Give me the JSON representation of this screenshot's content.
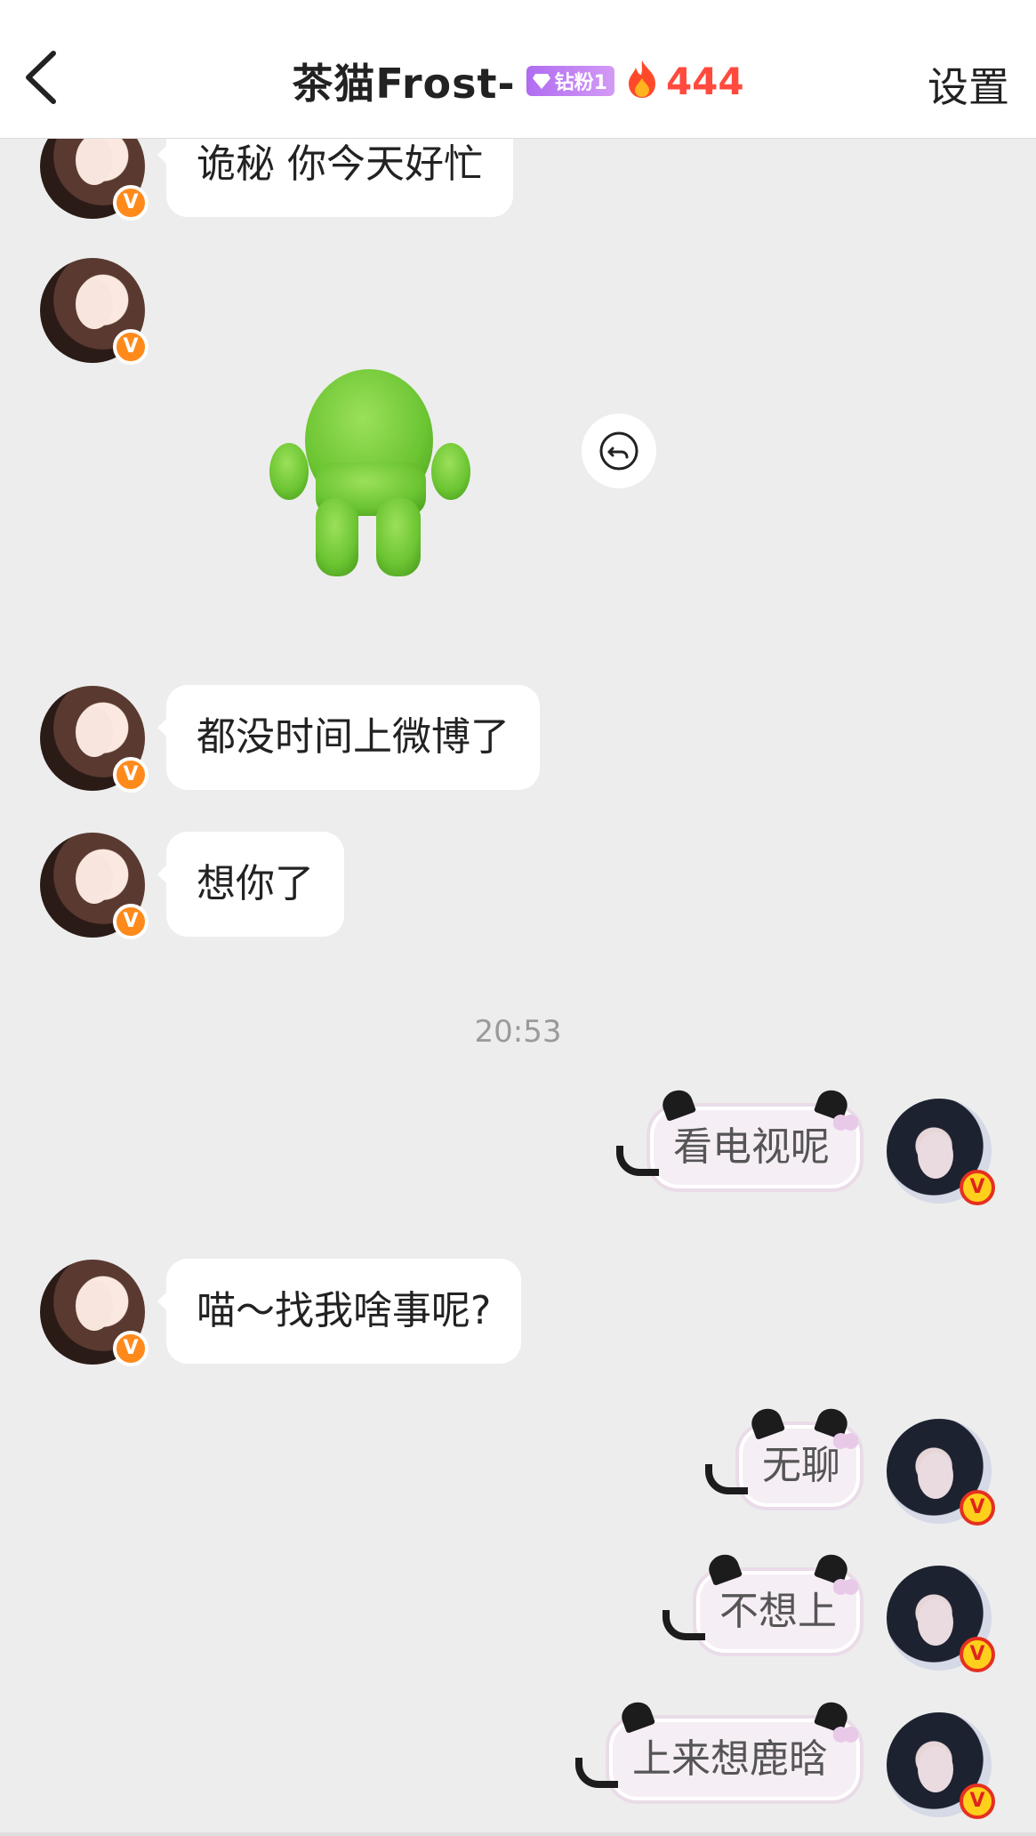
{
  "header": {
    "title": "茶猫Frost-",
    "fan_badge": "钻粉1",
    "heat_count": "444",
    "settings_label": "设置"
  },
  "messages": [
    {
      "side": "left",
      "text": "诡秘 你今天好忙"
    },
    {
      "side": "left",
      "type": "sticker"
    },
    {
      "side": "left",
      "text": "都没时间上微博了"
    },
    {
      "side": "left",
      "text": "想你了"
    },
    {
      "side": "right",
      "text": "看电视呢"
    },
    {
      "side": "left",
      "text": "喵～找我啥事呢?"
    },
    {
      "side": "right",
      "text": "无聊"
    },
    {
      "side": "right",
      "text": "不想上"
    },
    {
      "side": "right",
      "text": "上来想鹿晗"
    }
  ],
  "timestamp": "20:53",
  "verified_badge": "V",
  "colors": {
    "background": "#ededed",
    "heat": "#ff4a3d",
    "fan_badge": "#b06cf0",
    "verified": "#ff8a1c"
  }
}
